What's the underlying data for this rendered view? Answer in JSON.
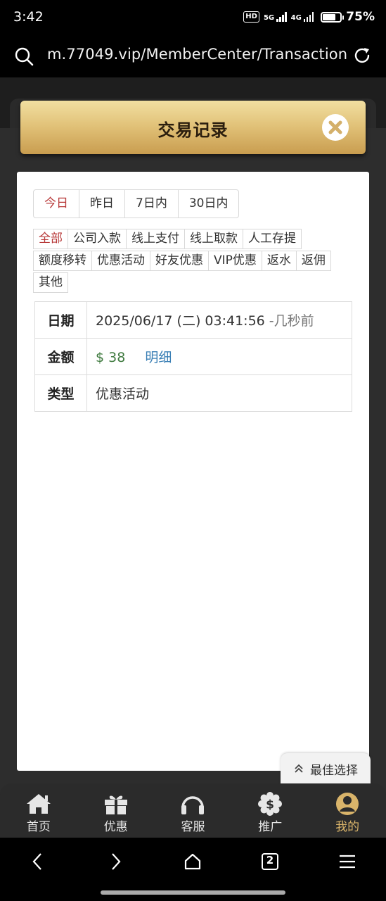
{
  "status_bar": {
    "time": "3:42",
    "hd": "HD",
    "net1": "5G",
    "net2": "4G",
    "battery_percent": 75,
    "battery_text": "75%"
  },
  "url_bar": {
    "url": "m.77049.vip/MemberCenter/Transaction"
  },
  "header": {
    "title": "交易记录"
  },
  "date_tabs": [
    {
      "label": "今日",
      "active": true
    },
    {
      "label": "昨日",
      "active": false
    },
    {
      "label": "7日内",
      "active": false
    },
    {
      "label": "30日内",
      "active": false
    }
  ],
  "type_filters": [
    {
      "label": "全部",
      "active": true
    },
    {
      "label": "公司入款",
      "active": false
    },
    {
      "label": "线上支付",
      "active": false
    },
    {
      "label": "线上取款",
      "active": false
    },
    {
      "label": "人工存提",
      "active": false
    },
    {
      "label": "额度移转",
      "active": false
    },
    {
      "label": "优惠活动",
      "active": false
    },
    {
      "label": "好友优惠",
      "active": false
    },
    {
      "label": "VIP优惠",
      "active": false
    },
    {
      "label": "返水",
      "active": false
    },
    {
      "label": "返佣",
      "active": false
    },
    {
      "label": "其他",
      "active": false
    }
  ],
  "record": {
    "date_label": "日期",
    "date_value": "2025/06/17 (二) 03:41:56",
    "date_ago": "-几秒前",
    "amount_label": "金额",
    "amount_value": "$ 38",
    "detail_link": "明细",
    "type_label": "类型",
    "type_value": "优惠活动"
  },
  "best_choice": {
    "label": "最佳选择"
  },
  "bottom_nav": [
    {
      "label": "首页",
      "icon": "home-icon",
      "active": false
    },
    {
      "label": "优惠",
      "icon": "gift-icon",
      "active": false
    },
    {
      "label": "客服",
      "icon": "headphones-icon",
      "active": false
    },
    {
      "label": "推广",
      "icon": "dollar-badge-icon",
      "active": false
    },
    {
      "label": "我的",
      "icon": "user-icon",
      "active": true
    }
  ],
  "system_nav": {
    "tabs_count": "2"
  },
  "colors": {
    "gold": "#e2c37a",
    "active_red": "#b83a3a",
    "amount_green": "#3f7a3f",
    "link_blue": "#3a7fb5",
    "nav_active": "#d9b46a"
  }
}
